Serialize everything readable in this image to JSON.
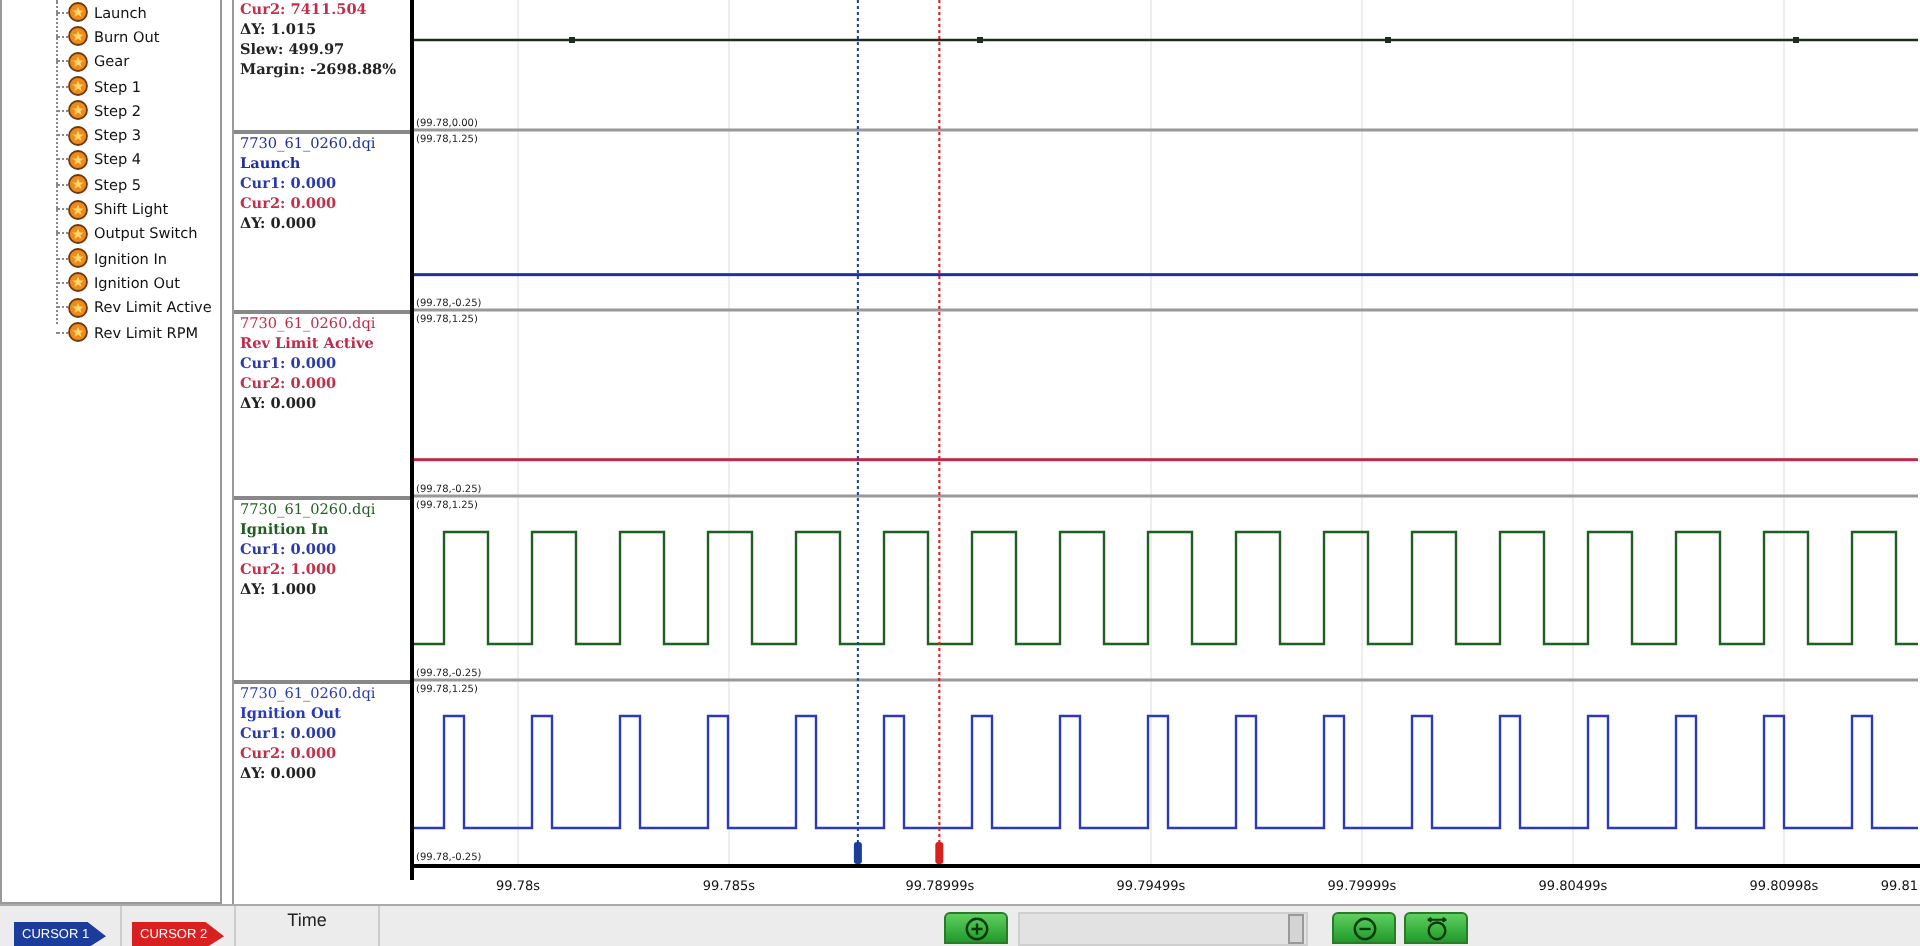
{
  "tree": {
    "items": [
      {
        "label": "Launch"
      },
      {
        "label": "Burn Out"
      },
      {
        "label": "Gear"
      },
      {
        "label": "Step 1"
      },
      {
        "label": "Step 2"
      },
      {
        "label": "Step 3"
      },
      {
        "label": "Step 4"
      },
      {
        "label": "Step 5"
      },
      {
        "label": "Shift Light"
      },
      {
        "label": "Output Switch"
      },
      {
        "label": "Ignition In"
      },
      {
        "label": "Ignition Out"
      },
      {
        "label": "Rev Limit Active"
      },
      {
        "label": "Rev Limit RPM"
      }
    ]
  },
  "channels": [
    {
      "kind": "dotted",
      "color": "#1e2e1e",
      "readings": [
        {
          "kind": "cur2",
          "text": "Cur2: 7411.504"
        },
        {
          "kind": "plain",
          "text": "ΔY: 1.015"
        },
        {
          "kind": "plain",
          "text": "Slew: 499.97"
        },
        {
          "kind": "plain",
          "text": "Margin: -2698.88%"
        }
      ],
      "range_bottom": "(99.78,0.00)"
    },
    {
      "kind": "flat",
      "file": "7730_61_0260.dqi",
      "name": "Launch",
      "color": "#1f2f9f",
      "readings": [
        {
          "kind": "cur1",
          "text": "Cur1: 0.000"
        },
        {
          "kind": "cur2",
          "text": "Cur2: 0.000"
        },
        {
          "kind": "plain",
          "text": "ΔY: 0.000"
        }
      ],
      "range_top": "(99.78,1.25)",
      "range_bottom": "(99.78,-0.25)"
    },
    {
      "kind": "flat",
      "file": "7730_61_0260.dqi",
      "name": "Rev Limit Active",
      "color": "#c02a4a",
      "readings": [
        {
          "kind": "cur1",
          "text": "Cur1: 0.000"
        },
        {
          "kind": "cur2",
          "text": "Cur2: 0.000"
        },
        {
          "kind": "plain",
          "text": "ΔY: 0.000"
        }
      ],
      "range_top": "(99.78,1.25)",
      "range_bottom": "(99.78,-0.25)"
    },
    {
      "kind": "square",
      "file": "7730_61_0260.dqi",
      "name": "Ignition In",
      "color": "#1f5f1f",
      "readings": [
        {
          "kind": "cur1",
          "text": "Cur1: 0.000"
        },
        {
          "kind": "cur2",
          "text": "Cur2: 1.000"
        },
        {
          "kind": "plain",
          "text": "ΔY: 1.000"
        }
      ],
      "range_top": "(99.78,1.25)",
      "range_bottom": "(99.78,-0.25)"
    },
    {
      "kind": "pulse",
      "file": "7730_61_0260.dqi",
      "name": "Ignition Out",
      "color": "#2a3ab8",
      "readings": [
        {
          "kind": "cur1",
          "text": "Cur1: 0.000"
        },
        {
          "kind": "cur2",
          "text": "Cur2: 0.000"
        },
        {
          "kind": "plain",
          "text": "ΔY: 0.000"
        }
      ],
      "range_top": "(99.78,1.25)",
      "range_bottom": "(99.78,-0.25)"
    }
  ],
  "time_axis": {
    "ticks": [
      "99.78s",
      "99.785s",
      "99.78999s",
      "99.79499s",
      "99.79999s",
      "99.80499s",
      "99.80998s",
      "99.81"
    ]
  },
  "cursors": [
    {
      "label": "CURSOR 1",
      "color": "#1c3c9c",
      "level": 0.297
    },
    {
      "label": "CURSOR 2",
      "color": "#d82020",
      "level": 0.351
    }
  ],
  "toolbar": {
    "time_label": "Time"
  }
}
